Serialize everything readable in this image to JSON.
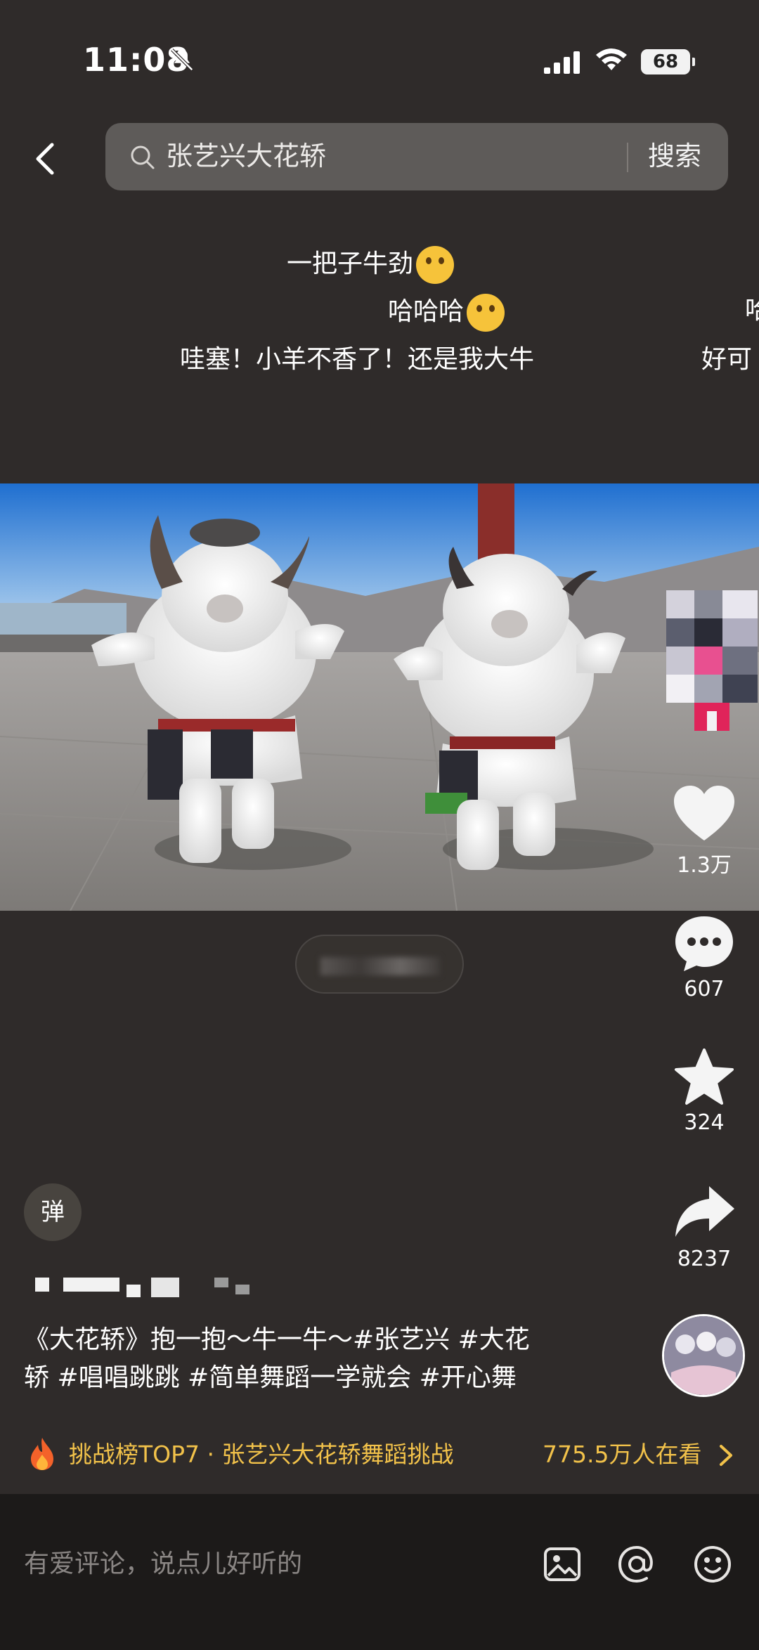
{
  "status_bar": {
    "time": "11:08",
    "battery": "68"
  },
  "search": {
    "query": "张艺兴大花轿",
    "button": "搜索"
  },
  "danmaku": [
    {
      "text": "一把子牛劲"
    },
    {
      "text": "哈哈哈"
    },
    {
      "text": "哇塞！小羊不香了！还是我大牛"
    },
    {
      "text": "好可"
    },
    {
      "text": "哈"
    }
  ],
  "actions": {
    "like_count": "1.3万",
    "comment_count": "607",
    "favorite_count": "324",
    "share_count": "8237"
  },
  "danmaku_toggle": "弹",
  "description": {
    "line1": "《大花轿》抱一抱～牛一牛～#张艺兴 #大花",
    "line2": "轿 #唱唱跳跳 #简单舞蹈一学就会 #开心舞"
  },
  "challenge": {
    "label": "挑战榜TOP7 · 张艺兴大花轿舞蹈挑战",
    "viewers": "775.5万人在看"
  },
  "comment_bar": {
    "placeholder": "有爱评论，说点儿好听的"
  },
  "colors": {
    "accent": "#f2c24a",
    "background": "#2f2b2a",
    "comment_bar": "#1c1a19"
  },
  "icons": [
    "bell-muted-icon",
    "signal-icon",
    "wifi-icon",
    "back-icon",
    "search-icon",
    "heart-icon",
    "comment-icon",
    "star-icon",
    "share-icon",
    "fire-icon",
    "chevron-right-icon",
    "image-icon",
    "at-icon",
    "emoji-icon"
  ]
}
